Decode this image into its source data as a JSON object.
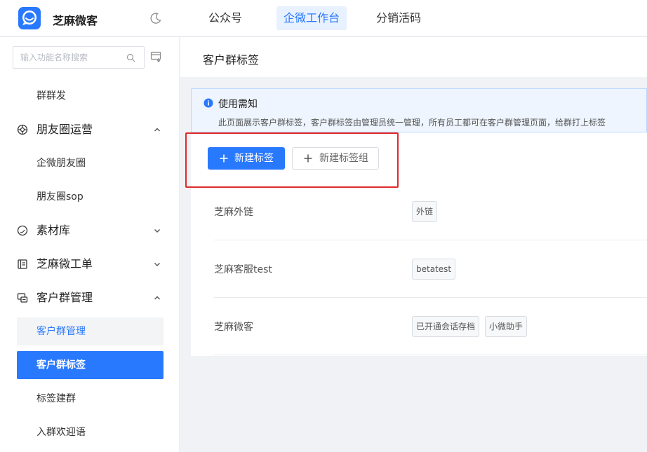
{
  "header": {
    "brand": "芝麻微客",
    "nav": [
      "公众号",
      "企微工作台",
      "分销活码"
    ],
    "active_nav": "企微工作台"
  },
  "sidebar": {
    "search_placeholder": "输入功能名称搜索",
    "items": {
      "qunqunfa": "群群发",
      "pengyouquan_group": "朋友圈运营",
      "qiwei_pyq": "企微朋友圈",
      "pyq_sop": "朋友圈sop",
      "sucai_group": "素材库",
      "gongdan_group": "芝麻微工单",
      "kehuqun_group": "客户群管理",
      "kehuqun_manage": "客户群管理",
      "kehuqun_tags": "客户群标签",
      "tag_build": "标签建群",
      "welcome": "入群欢迎语"
    }
  },
  "main": {
    "page_title": "客户群标签",
    "notice_title": "使用需知",
    "notice_text": "此页面展示客户群标签，客户群标签由管理员统一管理，所有员工都可在客户群管理页面，给群打上标签",
    "btn_new_tag": "新建标签",
    "btn_new_group": "新建标签组",
    "groups": [
      {
        "name": "芝麻外链",
        "tags": [
          "外链"
        ]
      },
      {
        "name": "芝麻客服test",
        "tags": [
          "betatest"
        ]
      },
      {
        "name": "芝麻微客",
        "tags": [
          "已开通会话存档",
          "小微助手"
        ]
      }
    ]
  },
  "colors": {
    "accent": "#2979ff",
    "highlight": "#e02a2a",
    "notice_bg": "#eef5ff"
  }
}
